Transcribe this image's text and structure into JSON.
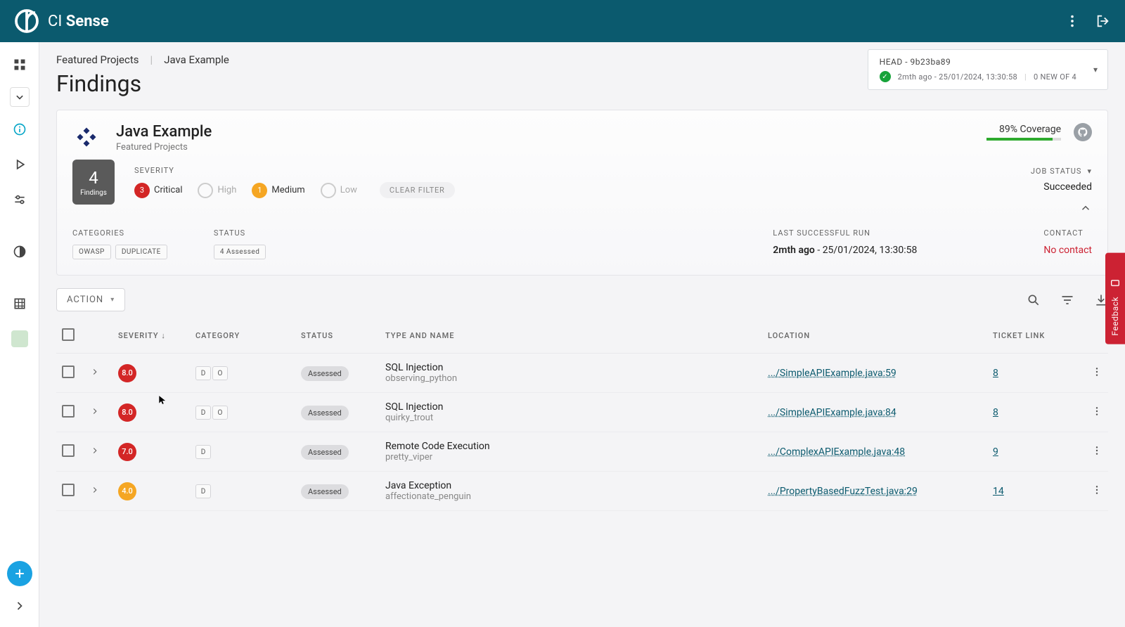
{
  "brand": {
    "name_bold": "CI ",
    "name_light": "Sense"
  },
  "breadcrumb": {
    "level1": "Featured Projects",
    "level2": "Java Example"
  },
  "page_title": "Findings",
  "run_card": {
    "head": "HEAD - 9b23ba89",
    "sub_left": "2mth ago - 25/01/2024, 13:30:58",
    "sub_right": "0 NEW OF 4"
  },
  "project": {
    "name": "Java Example",
    "subtitle": "Featured Projects",
    "findings_count": "4",
    "findings_label": "Findings",
    "coverage_text": "89% Coverage",
    "coverage_pct": 89,
    "severity_label": "SEVERITY",
    "sev_chips": [
      {
        "count": "3",
        "label": "Critical",
        "color": "#d32626",
        "empty": false
      },
      {
        "count": "",
        "label": "High",
        "color": "",
        "empty": true
      },
      {
        "count": "1",
        "label": "Medium",
        "color": "#f5a623",
        "empty": false
      },
      {
        "count": "",
        "label": "Low",
        "color": "",
        "empty": true
      }
    ],
    "clear_filter": "CLEAR FILTER",
    "job_status_label": "JOB STATUS",
    "job_status_value": "Succeeded",
    "categories_label": "CATEGORIES",
    "categories": [
      "OWASP",
      "DUPLICATE"
    ],
    "status_label": "STATUS",
    "status_value": "4 Assessed",
    "last_run_label": "LAST SUCCESSFUL RUN",
    "last_run_ago": "2mth ago",
    "last_run_sep": " - ",
    "last_run_ts": "25/01/2024, 13:30:58",
    "contact_label": "CONTACT",
    "contact_value": "No contact"
  },
  "action_button": "ACTION",
  "table": {
    "headers": {
      "severity": "SEVERITY",
      "category": "CATEGORY",
      "status": "STATUS",
      "type_name": "TYPE AND NAME",
      "location": "LOCATION",
      "ticket": "TICKET LINK"
    },
    "rows": [
      {
        "sev": "8.0",
        "sev_color": "#d32626",
        "cats": [
          "D",
          "O"
        ],
        "status": "Assessed",
        "type": "SQL Injection",
        "name": "observing_python",
        "loc": ".../SimpleAPIExample.java:59",
        "ticket": "8"
      },
      {
        "sev": "8.0",
        "sev_color": "#d32626",
        "cats": [
          "D",
          "O"
        ],
        "status": "Assessed",
        "type": "SQL Injection",
        "name": "quirky_trout",
        "loc": ".../SimpleAPIExample.java:84",
        "ticket": "8"
      },
      {
        "sev": "7.0",
        "sev_color": "#d32626",
        "cats": [
          "D"
        ],
        "status": "Assessed",
        "type": "Remote Code Execution",
        "name": "pretty_viper",
        "loc": ".../ComplexAPIExample.java:48",
        "ticket": "9"
      },
      {
        "sev": "4.0",
        "sev_color": "#f5a623",
        "cats": [
          "D"
        ],
        "status": "Assessed",
        "type": "Java Exception",
        "name": "affectionate_penguin",
        "loc": ".../PropertyBasedFuzzTest.java:29",
        "ticket": "14"
      }
    ]
  },
  "feedback_label": "Feedback"
}
